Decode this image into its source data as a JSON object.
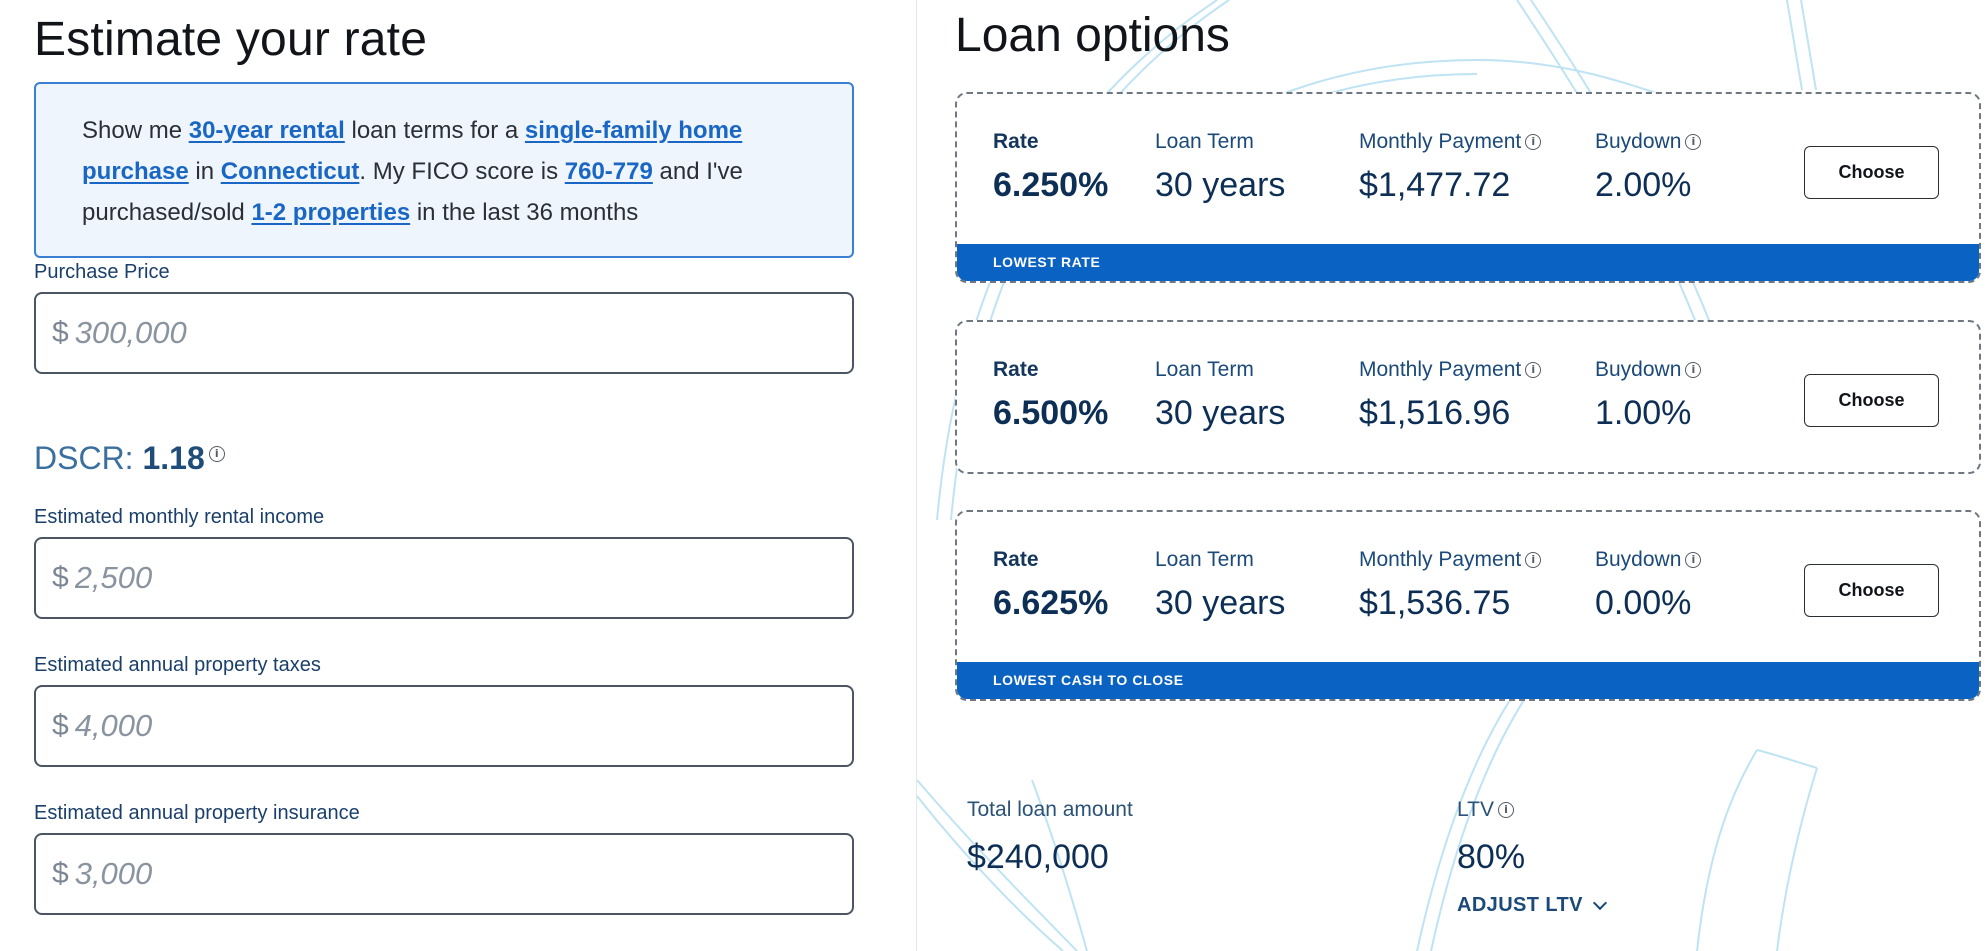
{
  "left": {
    "title": "Estimate your rate",
    "sentence": {
      "p1": "Show me ",
      "term": "30-year rental",
      "p2": " loan terms for a ",
      "property": "single-family home purchase",
      "p3": " in ",
      "state": "Connecticut",
      "p4": ". My FICO score is ",
      "fico": "760-779",
      "p5": " and I've purchased/sold ",
      "properties": "1-2 properties",
      "p6": " in the last 36 months"
    },
    "purchase_price": {
      "label": "Purchase Price",
      "placeholder": "300,000"
    },
    "dscr": {
      "label": "DSCR: ",
      "value": "1.18"
    },
    "rental_income": {
      "label": "Estimated monthly rental income",
      "placeholder": "2,500"
    },
    "property_taxes": {
      "label": "Estimated annual property taxes",
      "placeholder": "4,000"
    },
    "property_insurance": {
      "label": "Estimated annual property insurance",
      "placeholder": "3,000"
    },
    "currency_symbol": "$"
  },
  "right": {
    "title": "Loan options",
    "column_labels": {
      "rate": "Rate",
      "term": "Loan Term",
      "payment": "Monthly Payment",
      "buydown": "Buydown"
    },
    "choose_label": "Choose",
    "options": [
      {
        "rate": "6.250%",
        "term": "30 years",
        "payment": "$1,477.72",
        "buydown": "2.00%",
        "banner": "LOWEST RATE"
      },
      {
        "rate": "6.500%",
        "term": "30 years",
        "payment": "$1,516.96",
        "buydown": "1.00%",
        "banner": ""
      },
      {
        "rate": "6.625%",
        "term": "30 years",
        "payment": "$1,536.75",
        "buydown": "0.00%",
        "banner": "LOWEST CASH TO CLOSE"
      }
    ],
    "total_loan": {
      "label": "Total loan amount",
      "value": "$240,000"
    },
    "ltv": {
      "label": "LTV",
      "value": "80%",
      "adjust_label": "ADJUST LTV"
    }
  },
  "colors": {
    "accent": "#0a63c2",
    "link": "#1a66c4",
    "box_bg": "#eef5fd",
    "text_navy": "#0e2f55"
  }
}
